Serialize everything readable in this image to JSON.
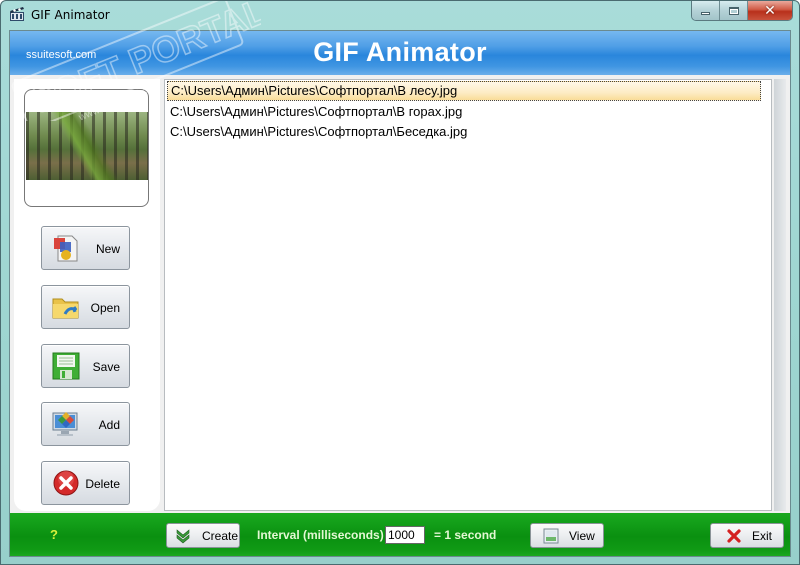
{
  "window": {
    "title": "GIF Animator",
    "caption_buttons": {
      "minimize": "minimize",
      "maximize": "maximize",
      "close": "close"
    }
  },
  "header": {
    "brand": "ssuitesoft.com",
    "heading": "GIF Animator"
  },
  "sidebar": {
    "preview_label": "preview-thumbnail",
    "buttons": [
      {
        "label": "New",
        "icon": "new-document-icon"
      },
      {
        "label": "Open",
        "icon": "open-folder-icon"
      },
      {
        "label": "Save",
        "icon": "floppy-disk-icon"
      },
      {
        "label": "Add",
        "icon": "add-monitor-icon"
      },
      {
        "label": "Delete",
        "icon": "delete-x-icon"
      }
    ]
  },
  "file_list": {
    "items": [
      {
        "path": "C:\\Users\\Админ\\Pictures\\Софтпортал\\В лесу.jpg",
        "selected": true
      },
      {
        "path": "C:\\Users\\Админ\\Pictures\\Софтпортал\\В горах.jpg",
        "selected": false
      },
      {
        "path": "C:\\Users\\Админ\\Pictures\\Софтпортал\\Беседка.jpg",
        "selected": false
      }
    ]
  },
  "footer": {
    "help": "?",
    "create_label": "Create",
    "interval_label": "Interval (milliseconds)",
    "interval_value": "1000",
    "interval_suffix": "= 1 second",
    "view_label": "View",
    "exit_label": "Exit"
  },
  "watermark": {
    "text": "SOFT PORTAL",
    "url": "www.softportal.com"
  },
  "colors": {
    "header_blue": "#2a86dc",
    "footer_green": "#0a9010",
    "help_yellow": "#d8f03c",
    "selection": "#fdecc4",
    "delete_red": "#d42a2a"
  }
}
